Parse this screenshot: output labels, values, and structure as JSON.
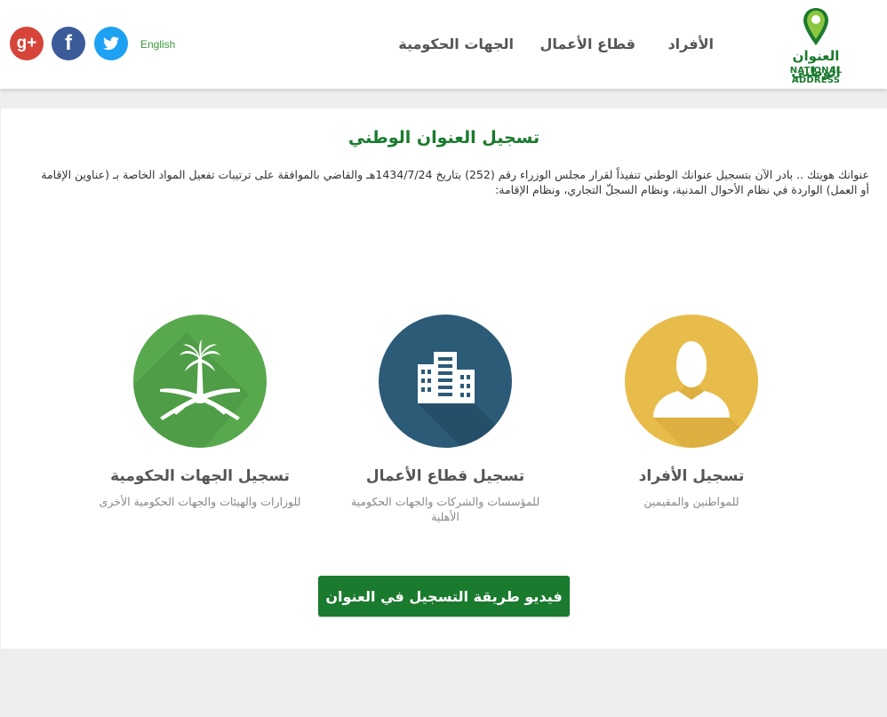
{
  "header": {
    "logo": {
      "arabic": "العنوان الوطني",
      "english": "NATIONAL ADDRESS"
    },
    "nav": [
      {
        "label": "الأفراد"
      },
      {
        "label": "قطاع الأعمال"
      },
      {
        "label": "الجهات الحكومية"
      }
    ],
    "language_label": "English",
    "social": [
      {
        "icon": "twitter-icon"
      },
      {
        "icon": "facebook-icon"
      },
      {
        "icon": "google-plus-icon"
      }
    ]
  },
  "main": {
    "title": "تسجيل العنوان الوطني",
    "intro": "عنوانك هويتك .. بادر الآن بتسجيل عنوانك الوطني تنفيذاً لقرار مجلس الوزراء رقم (252) بتاريخ 1434/7/24هـ والقاضي بالموافقة على ترتيبات تفعيل المواد الخاصة بـ (عناوين الإقامة أو العمل) الواردة في نظام الأحوال المدنية، ونظام السجلّ التجاري، ونظام الإقامة:",
    "cards": [
      {
        "title": "تسجيل الأفراد",
        "desc": "للمواطنين والمقيمين",
        "icon": "person-icon",
        "color": "#e8bc4a"
      },
      {
        "title": "تسجيل قطاع الأعمال",
        "desc": "للمؤسسات والشركات والجهات الحكومية الأهلية",
        "icon": "buildings-icon",
        "color": "#2c5b78"
      },
      {
        "title": "تسجيل الجهات الحكومية",
        "desc": "للوزارات والهيئات والجهات الحكومية الأخرى",
        "icon": "palm-swords-emblem-icon",
        "color": "#58a84e"
      }
    ],
    "video_button": "فيديو طريقة التسجيل في العنوان"
  },
  "colors": {
    "brand_green": "#1a7a2e",
    "link_green": "#3a9a3a",
    "footer_gray": "#eeeeee"
  }
}
